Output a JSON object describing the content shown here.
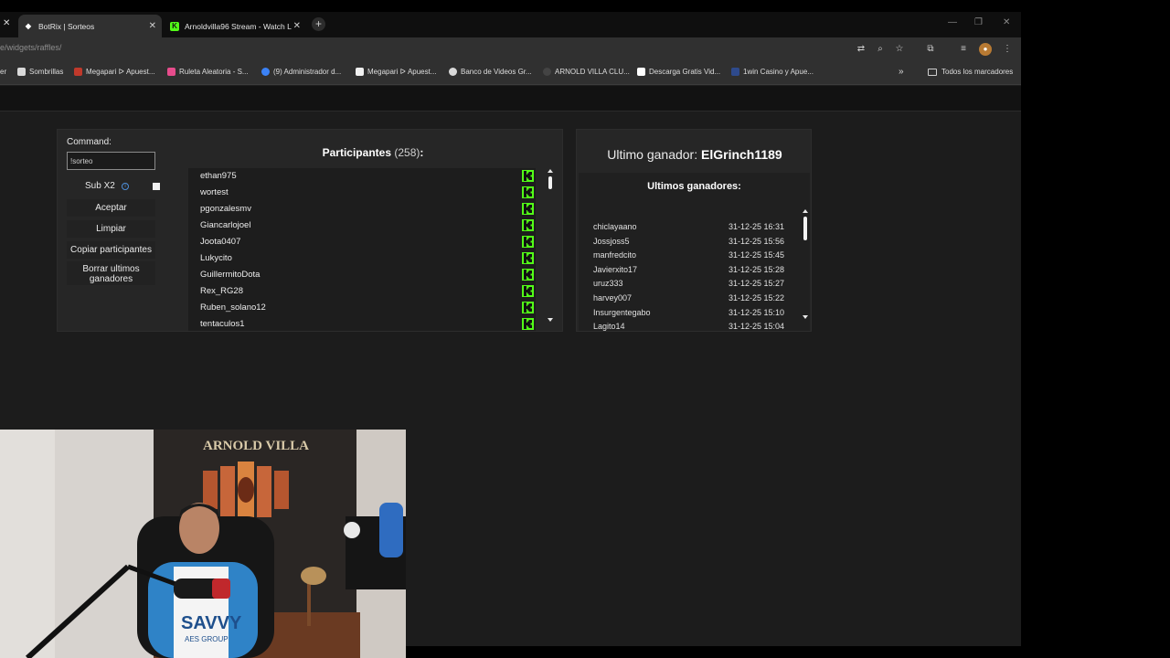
{
  "browser": {
    "tabs": [
      {
        "title": "BotRix | Sorteos",
        "active": true
      },
      {
        "title": "Arnoldvilla96 Stream - Watch L",
        "active": false
      }
    ],
    "url_visible": "e/widgets/raffles/"
  },
  "bookmarks": {
    "items": [
      {
        "label": "er",
        "color": ""
      },
      {
        "label": "Sombrillas",
        "color": "#d9d9d9"
      },
      {
        "label": "Megapari ᐅ Apuest...",
        "color": "#c0392b"
      },
      {
        "label": "Ruleta Aleatoria - S...",
        "color": "#e74c8c"
      },
      {
        "label": "(9) Administrador d...",
        "color": "#3b82f6"
      },
      {
        "label": "Megapari ᐅ Apuest...",
        "color": "#f0f0f0"
      },
      {
        "label": "Banco de Videos Gr...",
        "color": "#d9d9d9"
      },
      {
        "label": "ARNOLD VILLA CLU...",
        "color": "#444444"
      },
      {
        "label": "Descarga Gratis Vid...",
        "color": "#ffffff"
      },
      {
        "label": "1win Casino y Apue...",
        "color": "#2e4a8c"
      }
    ],
    "more": "»",
    "folder": "Todos los marcadores"
  },
  "raffle": {
    "command_label": "Command:",
    "command_value": "!sorteo",
    "sub_label": "Sub X2",
    "sub_checked": false,
    "buttons": {
      "accept": "Aceptar",
      "clear": "Limpiar",
      "copy": "Copiar participantes",
      "clear_winners_line1": "Borrar ultimos",
      "clear_winners_line2": "ganadores"
    },
    "participants_title": "Participantes",
    "participants_count": "(258)",
    "participants_colon": ":",
    "participants": [
      "ethan975",
      "wortest",
      "pgonzalesmv",
      "Giancarlojoel",
      "Joota0407",
      "Lukycito",
      "GuillermitoDota",
      "Rex_RG28",
      "Ruben_solano12",
      "tentaculos1"
    ]
  },
  "winners": {
    "last_winner_label": "Ultimo ganador:",
    "last_winner_name": "ElGrinch1189",
    "list_title": "Ultimos ganadores:",
    "list": [
      {
        "name": "chiclayaano",
        "date": "31-12-25 16:31"
      },
      {
        "name": "Jossjoss5",
        "date": "31-12-25 15:56"
      },
      {
        "name": "manfredcito",
        "date": "31-12-25 15:45"
      },
      {
        "name": "Javierxito17",
        "date": "31-12-25 15:28"
      },
      {
        "name": "uruz333",
        "date": "31-12-25 15:27"
      },
      {
        "name": "harvey007",
        "date": "31-12-25 15:22"
      },
      {
        "name": "Insurgentegabo",
        "date": "31-12-25 15:10"
      },
      {
        "name": "Lagito14",
        "date": "31-12-25 15:04"
      }
    ]
  },
  "webcam": {
    "sign": "ARNOLD VILLA",
    "shirt_text": "SAVVY",
    "shirt_sub": "AES GROUP"
  },
  "colors": {
    "kick_green": "#53fc18",
    "info_blue": "#4e8fd9"
  }
}
